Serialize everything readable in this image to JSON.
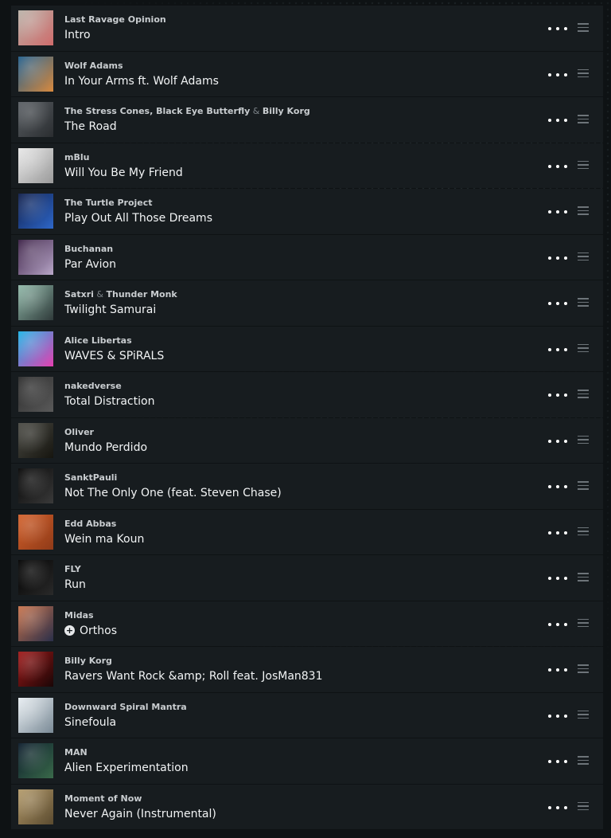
{
  "tracks": [
    {
      "artists": [
        "Last Ravage Opinion"
      ],
      "title": "Intro",
      "colors": [
        "#b9b2a8",
        "#cf6b6b"
      ]
    },
    {
      "artists": [
        "Wolf Adams"
      ],
      "title": "In Your Arms ft. Wolf Adams",
      "colors": [
        "#1f5d8c",
        "#d98a3e"
      ]
    },
    {
      "artists": [
        "The Stress Cones",
        "Black Eye Butterfly",
        "Billy Korg"
      ],
      "title": "The Road",
      "colors": [
        "#5a5f64",
        "#2a2d30"
      ]
    },
    {
      "artists": [
        "mBlu"
      ],
      "title": "Will You Be My Friend",
      "colors": [
        "#e8e8e8",
        "#9a9a9a"
      ]
    },
    {
      "artists": [
        "The Turtle Project"
      ],
      "title": "Play Out All Those Dreams",
      "colors": [
        "#0f1e4a",
        "#2e67c9"
      ]
    },
    {
      "artists": [
        "Buchanan"
      ],
      "title": "Par Avion",
      "colors": [
        "#3a1f45",
        "#b9a8c9"
      ]
    },
    {
      "artists": [
        "Satxri",
        "Thunder Monk"
      ],
      "title": "Twilight Samurai",
      "colors": [
        "#8fb8a8",
        "#2f3a3a"
      ]
    },
    {
      "artists": [
        "Alice Libertas"
      ],
      "title": "WAVES & SPiRALS",
      "colors": [
        "#19b3e6",
        "#e63fb0"
      ]
    },
    {
      "artists": [
        "nakedverse"
      ],
      "title": "Total Distraction",
      "colors": [
        "#2b2b2b",
        "#5a5a5a"
      ]
    },
    {
      "artists": [
        "Oliver"
      ],
      "title": "Mundo Perdido",
      "colors": [
        "#4a4a44",
        "#16150f"
      ]
    },
    {
      "artists": [
        "SanktPauli"
      ],
      "title": "Not The Only One (feat. Steven Chase)",
      "colors": [
        "#050505",
        "#3a3a3a"
      ]
    },
    {
      "artists": [
        "Edd Abbas"
      ],
      "title": "Wein ma Koun",
      "colors": [
        "#d2602a",
        "#8f3a18"
      ]
    },
    {
      "artists": [
        "FLY"
      ],
      "title": "Run",
      "colors": [
        "#000000",
        "#2a2a2a"
      ]
    },
    {
      "artists": [
        "Midas"
      ],
      "title": "Orthos",
      "badge": "+",
      "colors": [
        "#c8724a",
        "#2a2f4a"
      ]
    },
    {
      "artists": [
        "Billy Korg"
      ],
      "title": "Ravers Want Rock &amp; Roll feat. JosMan831",
      "colors": [
        "#a01818",
        "#1a0606"
      ]
    },
    {
      "artists": [
        "Downward Spiral Mantra"
      ],
      "title": "Sinefoula",
      "colors": [
        "#e8eef2",
        "#7a8a96"
      ]
    },
    {
      "artists": [
        "MAN"
      ],
      "title": "Alien Experimentation",
      "colors": [
        "#0a1a2a",
        "#3a6a4a"
      ]
    },
    {
      "artists": [
        "Moment of Now"
      ],
      "title": "Never Again (Instrumental)",
      "colors": [
        "#b39a6a",
        "#5a4a2f"
      ]
    }
  ],
  "artist_separators": {
    "middle": ", ",
    "last": " & "
  },
  "icons": {
    "more": "more-dots-icon",
    "drag": "drag-handle-icon",
    "badge": "plus-circle-icon"
  }
}
